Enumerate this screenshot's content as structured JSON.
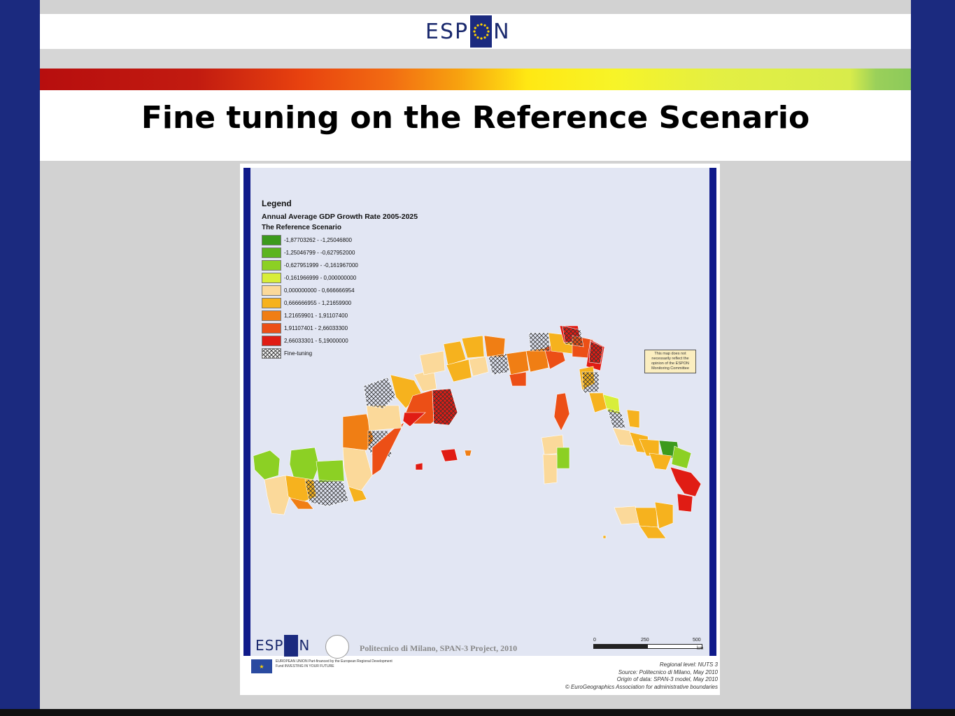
{
  "slide": {
    "logo_left": "ESP",
    "logo_right": "N",
    "title": "Fine tuning on the Reference Scenario"
  },
  "legend": {
    "heading": "Legend",
    "subtitle": "Annual Average GDP Growth Rate 2005-2025",
    "scenario": "The Reference Scenario",
    "classes": [
      {
        "label": "-1,87703262 - -1,25046800",
        "color": "#3c9a1c"
      },
      {
        "label": "-1,25046799 - -0,627952000",
        "color": "#5cb41f"
      },
      {
        "label": "-0,627951999 - -0,161967000",
        "color": "#8cd024"
      },
      {
        "label": "-0,161966999 - 0,000000000",
        "color": "#d8ee3a"
      },
      {
        "label": "0,000000000 - 0,666666954",
        "color": "#fbd99a"
      },
      {
        "label": "0,666666955 - 1,21659900",
        "color": "#f6b21e"
      },
      {
        "label": "1,21659901 - 1,91107400",
        "color": "#f07e14"
      },
      {
        "label": "1,91107401 - 2,66033300",
        "color": "#ec4f16"
      },
      {
        "label": "2,66033301 - 5,19000000",
        "color": "#e01c14"
      }
    ],
    "fine_tuning_label": "Fine-tuning"
  },
  "map": {
    "disclaimer": "This map does not necessarily reflect the opinion of the ESPON Monitoring Committee",
    "credit": "Politecnico di Milano, SPAN-3 Project, 2010",
    "espon_left": "ESP",
    "espon_right": "N",
    "scale": {
      "tick0": "0",
      "tick1": "250",
      "tick2": "500",
      "unit": "km"
    },
    "footer": {
      "line1": "Regional level: NUTS 3",
      "line2": "Source: Politecnico di Milano, May 2010",
      "line3": "Origin of data: SPAN-3 model, May 2010",
      "line4": "© EuroGeographics Association for administrative boundaries"
    },
    "eu_text": "EUROPEAN UNION Part-financed by the European Regional Development Fund INVESTING IN YOUR FUTURE"
  }
}
